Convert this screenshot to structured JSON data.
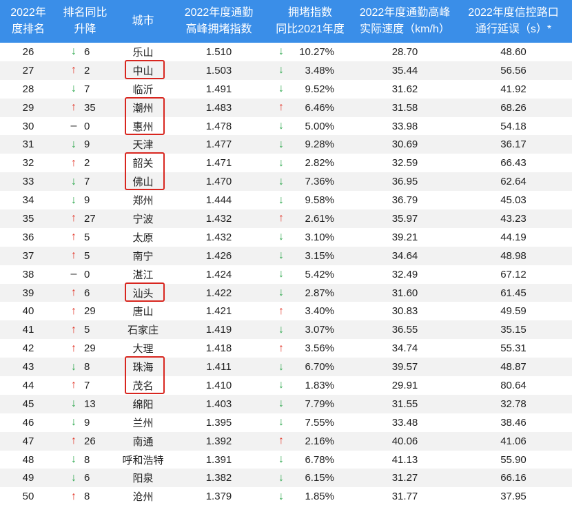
{
  "chart_data": {
    "type": "table",
    "columns": [
      {
        "lines": [
          "2022年",
          "度排名"
        ]
      },
      {
        "lines": [
          "排名同比",
          "升降"
        ]
      },
      {
        "lines": [
          "城市"
        ]
      },
      {
        "lines": [
          "2022年度通勤",
          "高峰拥堵指数"
        ]
      },
      {
        "lines": [
          "拥堵指数",
          "同比2021年度"
        ]
      },
      {
        "lines": [
          "2022年度通勤高峰",
          "实际速度（km/h）"
        ]
      },
      {
        "lines": [
          "2022年度信控路口",
          "通行延误（s）*"
        ]
      }
    ],
    "rows": [
      {
        "rank": "26",
        "rank_change_arrow": "↓",
        "rank_change": "6",
        "city": "乐山",
        "congestion_index": "1.510",
        "yoy_arrow": "↓",
        "yoy_change": "10.27%",
        "speed": "28.70",
        "delay": "48.60"
      },
      {
        "rank": "27",
        "rank_change_arrow": "↑",
        "rank_change": "2",
        "city": "中山",
        "congestion_index": "1.503",
        "yoy_arrow": "↓",
        "yoy_change": "3.48%",
        "speed": "35.44",
        "delay": "56.56"
      },
      {
        "rank": "28",
        "rank_change_arrow": "↓",
        "rank_change": "7",
        "city": "临沂",
        "congestion_index": "1.491",
        "yoy_arrow": "↓",
        "yoy_change": "9.52%",
        "speed": "31.62",
        "delay": "41.92"
      },
      {
        "rank": "29",
        "rank_change_arrow": "↑",
        "rank_change": "35",
        "city": "潮州",
        "congestion_index": "1.483",
        "yoy_arrow": "↑",
        "yoy_change": "6.46%",
        "speed": "31.58",
        "delay": "68.26"
      },
      {
        "rank": "30",
        "rank_change_arrow": "–",
        "rank_change": "0",
        "city": "惠州",
        "congestion_index": "1.478",
        "yoy_arrow": "↓",
        "yoy_change": "5.00%",
        "speed": "33.98",
        "delay": "54.18"
      },
      {
        "rank": "31",
        "rank_change_arrow": "↓",
        "rank_change": "9",
        "city": "天津",
        "congestion_index": "1.477",
        "yoy_arrow": "↓",
        "yoy_change": "9.28%",
        "speed": "30.69",
        "delay": "36.17"
      },
      {
        "rank": "32",
        "rank_change_arrow": "↑",
        "rank_change": "2",
        "city": "韶关",
        "congestion_index": "1.471",
        "yoy_arrow": "↓",
        "yoy_change": "2.82%",
        "speed": "32.59",
        "delay": "66.43"
      },
      {
        "rank": "33",
        "rank_change_arrow": "↓",
        "rank_change": "7",
        "city": "佛山",
        "congestion_index": "1.470",
        "yoy_arrow": "↓",
        "yoy_change": "7.36%",
        "speed": "36.95",
        "delay": "62.64"
      },
      {
        "rank": "34",
        "rank_change_arrow": "↓",
        "rank_change": "9",
        "city": "郑州",
        "congestion_index": "1.444",
        "yoy_arrow": "↓",
        "yoy_change": "9.58%",
        "speed": "36.79",
        "delay": "45.03"
      },
      {
        "rank": "35",
        "rank_change_arrow": "↑",
        "rank_change": "27",
        "city": "宁波",
        "congestion_index": "1.432",
        "yoy_arrow": "↑",
        "yoy_change": "2.61%",
        "speed": "35.97",
        "delay": "43.23"
      },
      {
        "rank": "36",
        "rank_change_arrow": "↑",
        "rank_change": "5",
        "city": "太原",
        "congestion_index": "1.432",
        "yoy_arrow": "↓",
        "yoy_change": "3.10%",
        "speed": "39.21",
        "delay": "44.19"
      },
      {
        "rank": "37",
        "rank_change_arrow": "↑",
        "rank_change": "5",
        "city": "南宁",
        "congestion_index": "1.426",
        "yoy_arrow": "↓",
        "yoy_change": "3.15%",
        "speed": "34.64",
        "delay": "48.98"
      },
      {
        "rank": "38",
        "rank_change_arrow": "–",
        "rank_change": "0",
        "city": "湛江",
        "congestion_index": "1.424",
        "yoy_arrow": "↓",
        "yoy_change": "5.42%",
        "speed": "32.49",
        "delay": "67.12"
      },
      {
        "rank": "39",
        "rank_change_arrow": "↑",
        "rank_change": "6",
        "city": "汕头",
        "congestion_index": "1.422",
        "yoy_arrow": "↓",
        "yoy_change": "2.87%",
        "speed": "31.60",
        "delay": "61.45"
      },
      {
        "rank": "40",
        "rank_change_arrow": "↑",
        "rank_change": "29",
        "city": "唐山",
        "congestion_index": "1.421",
        "yoy_arrow": "↑",
        "yoy_change": "3.40%",
        "speed": "30.83",
        "delay": "49.59"
      },
      {
        "rank": "41",
        "rank_change_arrow": "↑",
        "rank_change": "5",
        "city": "石家庄",
        "congestion_index": "1.419",
        "yoy_arrow": "↓",
        "yoy_change": "3.07%",
        "speed": "36.55",
        "delay": "35.15"
      },
      {
        "rank": "42",
        "rank_change_arrow": "↑",
        "rank_change": "29",
        "city": "大理",
        "congestion_index": "1.418",
        "yoy_arrow": "↑",
        "yoy_change": "3.56%",
        "speed": "34.74",
        "delay": "55.31"
      },
      {
        "rank": "43",
        "rank_change_arrow": "↓",
        "rank_change": "8",
        "city": "珠海",
        "congestion_index": "1.411",
        "yoy_arrow": "↓",
        "yoy_change": "6.70%",
        "speed": "39.57",
        "delay": "48.87"
      },
      {
        "rank": "44",
        "rank_change_arrow": "↑",
        "rank_change": "7",
        "city": "茂名",
        "congestion_index": "1.410",
        "yoy_arrow": "↓",
        "yoy_change": "1.83%",
        "speed": "29.91",
        "delay": "80.64"
      },
      {
        "rank": "45",
        "rank_change_arrow": "↓",
        "rank_change": "13",
        "city": "绵阳",
        "congestion_index": "1.403",
        "yoy_arrow": "↓",
        "yoy_change": "7.79%",
        "speed": "31.55",
        "delay": "32.78"
      },
      {
        "rank": "46",
        "rank_change_arrow": "↓",
        "rank_change": "9",
        "city": "兰州",
        "congestion_index": "1.395",
        "yoy_arrow": "↓",
        "yoy_change": "7.55%",
        "speed": "33.48",
        "delay": "38.46"
      },
      {
        "rank": "47",
        "rank_change_arrow": "↑",
        "rank_change": "26",
        "city": "南通",
        "congestion_index": "1.392",
        "yoy_arrow": "↑",
        "yoy_change": "2.16%",
        "speed": "40.06",
        "delay": "41.06"
      },
      {
        "rank": "48",
        "rank_change_arrow": "↓",
        "rank_change": "8",
        "city": "呼和浩特",
        "congestion_index": "1.391",
        "yoy_arrow": "↓",
        "yoy_change": "6.78%",
        "speed": "41.13",
        "delay": "55.90"
      },
      {
        "rank": "49",
        "rank_change_arrow": "↓",
        "rank_change": "6",
        "city": "阳泉",
        "congestion_index": "1.382",
        "yoy_arrow": "↓",
        "yoy_change": "6.15%",
        "speed": "31.27",
        "delay": "66.16"
      },
      {
        "rank": "50",
        "rank_change_arrow": "↑",
        "rank_change": "8",
        "city": "沧州",
        "congestion_index": "1.379",
        "yoy_arrow": "↓",
        "yoy_change": "1.85%",
        "speed": "31.77",
        "delay": "37.95"
      }
    ],
    "highlighted_ranks": [
      [
        27
      ],
      [
        29,
        30
      ],
      [
        32,
        33
      ],
      [
        39
      ],
      [
        43,
        44
      ]
    ]
  },
  "colors": {
    "header_bg": "#3a8ee8",
    "header_text": "#ffffff",
    "row_stripe": "#f2f2f2",
    "up_arrow": "#e23b2e",
    "down_arrow": "#2fa84f",
    "flat": "#333333",
    "highlight_box": "#d8261f"
  }
}
